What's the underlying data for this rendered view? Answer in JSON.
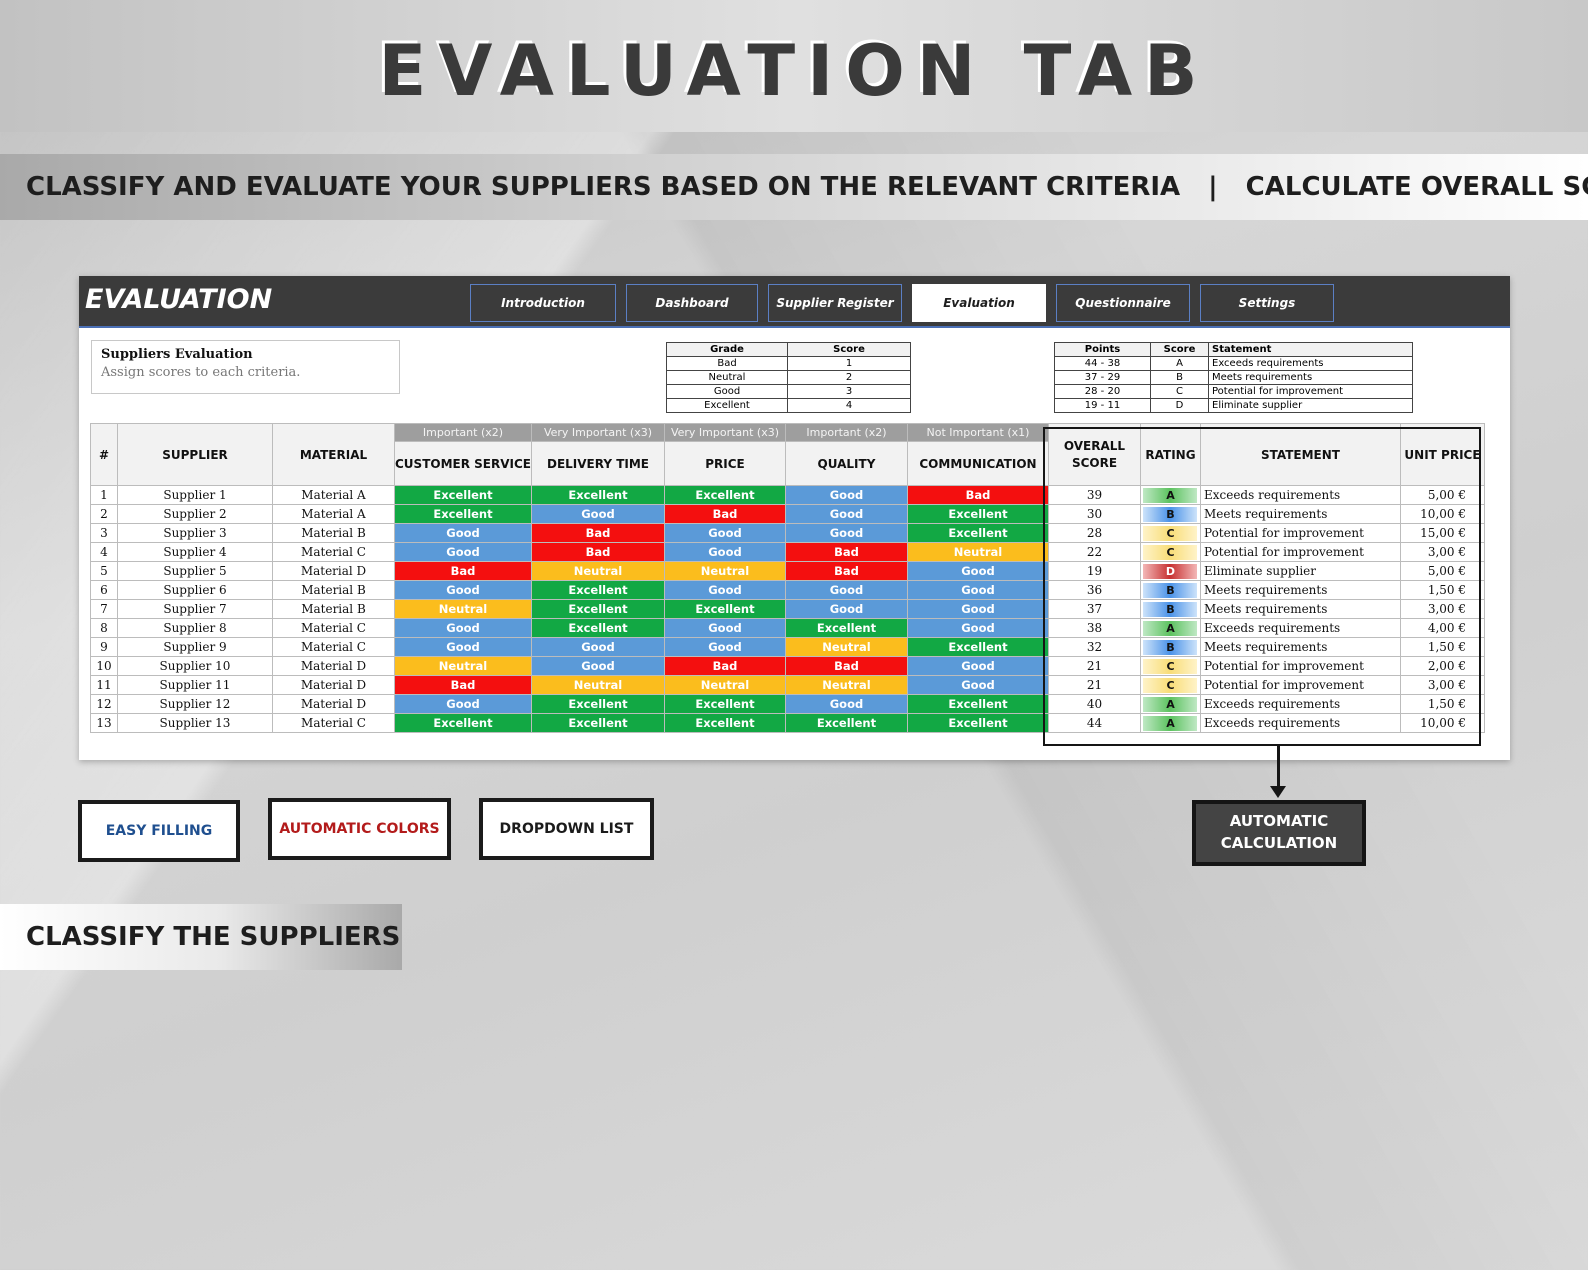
{
  "title": "EVALUATION TAB",
  "subtitle": {
    "left": "CLASSIFY AND EVALUATE YOUR SUPPLIERS BASED ON THE RELEVANT CRITERIA",
    "separator": "|",
    "right": "CALCULATE  OVERALL SCORE"
  },
  "sheet": {
    "title": "EVALUATION",
    "tabs": [
      "Introduction",
      "Dashboard",
      "Supplier Register",
      "Evaluation",
      "Questionnaire",
      "Settings"
    ],
    "active_tab": "Evaluation",
    "info": {
      "title": "Suppliers Evaluation",
      "description": "Assign scores to each criteria."
    },
    "grade_legend": {
      "headers": [
        "Grade",
        "Score"
      ],
      "rows": [
        [
          "Bad",
          "1"
        ],
        [
          "Neutral",
          "2"
        ],
        [
          "Good",
          "3"
        ],
        [
          "Excellent",
          "4"
        ]
      ]
    },
    "rating_legend": {
      "headers": [
        "Points",
        "Score",
        "Statement"
      ],
      "rows": [
        [
          "44 - 38",
          "A",
          "Exceeds requirements"
        ],
        [
          "37 - 29",
          "B",
          "Meets requirements"
        ],
        [
          "28 - 20",
          "C",
          "Potential for improvement"
        ],
        [
          "19 - 11",
          "D",
          "Eliminate supplier"
        ]
      ]
    },
    "table": {
      "headers": {
        "index": "#",
        "supplier": "SUPPLIER",
        "material": "MATERIAL",
        "overall_score": "OVERALL SCORE",
        "rating": "RATING",
        "statement": "STATEMENT",
        "unit_price": "UNIT PRICE"
      },
      "criteria": [
        {
          "weight": "Important (x2)",
          "name": "CUSTOMER SERVICE"
        },
        {
          "weight": "Very Important (x3)",
          "name": "DELIVERY TIME"
        },
        {
          "weight": "Very Important (x3)",
          "name": "PRICE"
        },
        {
          "weight": "Important (x2)",
          "name": "QUALITY"
        },
        {
          "weight": "Not Important (x1)",
          "name": "COMMUNICATION"
        }
      ],
      "rows": [
        {
          "n": "1",
          "supplier": "Supplier 1",
          "material": "Material A",
          "grades": [
            "Excellent",
            "Excellent",
            "Excellent",
            "Good",
            "Bad"
          ],
          "score": "39",
          "rating": "A",
          "statement": "Exceeds requirements",
          "price": "5,00 €"
        },
        {
          "n": "2",
          "supplier": "Supplier 2",
          "material": "Material A",
          "grades": [
            "Excellent",
            "Good",
            "Bad",
            "Good",
            "Excellent"
          ],
          "score": "30",
          "rating": "B",
          "statement": "Meets requirements",
          "price": "10,00 €"
        },
        {
          "n": "3",
          "supplier": "Supplier 3",
          "material": "Material B",
          "grades": [
            "Good",
            "Bad",
            "Good",
            "Good",
            "Excellent"
          ],
          "score": "28",
          "rating": "C",
          "statement": "Potential for improvement",
          "price": "15,00 €"
        },
        {
          "n": "4",
          "supplier": "Supplier 4",
          "material": "Material C",
          "grades": [
            "Good",
            "Bad",
            "Good",
            "Bad",
            "Neutral"
          ],
          "score": "22",
          "rating": "C",
          "statement": "Potential for improvement",
          "price": "3,00 €"
        },
        {
          "n": "5",
          "supplier": "Supplier 5",
          "material": "Material D",
          "grades": [
            "Bad",
            "Neutral",
            "Neutral",
            "Bad",
            "Good"
          ],
          "score": "19",
          "rating": "D",
          "statement": "Eliminate supplier",
          "price": "5,00 €"
        },
        {
          "n": "6",
          "supplier": "Supplier 6",
          "material": "Material B",
          "grades": [
            "Good",
            "Excellent",
            "Good",
            "Good",
            "Good"
          ],
          "score": "36",
          "rating": "B",
          "statement": "Meets requirements",
          "price": "1,50 €"
        },
        {
          "n": "7",
          "supplier": "Supplier 7",
          "material": "Material B",
          "grades": [
            "Neutral",
            "Excellent",
            "Excellent",
            "Good",
            "Good"
          ],
          "score": "37",
          "rating": "B",
          "statement": "Meets requirements",
          "price": "3,00 €"
        },
        {
          "n": "8",
          "supplier": "Supplier 8",
          "material": "Material C",
          "grades": [
            "Good",
            "Excellent",
            "Good",
            "Excellent",
            "Good"
          ],
          "score": "38",
          "rating": "A",
          "statement": "Exceeds requirements",
          "price": "4,00 €"
        },
        {
          "n": "9",
          "supplier": "Supplier 9",
          "material": "Material C",
          "grades": [
            "Good",
            "Good",
            "Good",
            "Neutral",
            "Excellent"
          ],
          "score": "32",
          "rating": "B",
          "statement": "Meets requirements",
          "price": "1,50 €"
        },
        {
          "n": "10",
          "supplier": "Supplier 10",
          "material": "Material D",
          "grades": [
            "Neutral",
            "Good",
            "Bad",
            "Bad",
            "Good"
          ],
          "score": "21",
          "rating": "C",
          "statement": "Potential for improvement",
          "price": "2,00 €"
        },
        {
          "n": "11",
          "supplier": "Supplier 11",
          "material": "Material D",
          "grades": [
            "Bad",
            "Neutral",
            "Neutral",
            "Neutral",
            "Good"
          ],
          "score": "21",
          "rating": "C",
          "statement": "Potential for improvement",
          "price": "3,00 €"
        },
        {
          "n": "12",
          "supplier": "Supplier 12",
          "material": "Material D",
          "grades": [
            "Good",
            "Excellent",
            "Excellent",
            "Good",
            "Excellent"
          ],
          "score": "40",
          "rating": "A",
          "statement": "Exceeds requirements",
          "price": "1,50 €"
        },
        {
          "n": "13",
          "supplier": "Supplier 13",
          "material": "Material C",
          "grades": [
            "Excellent",
            "Excellent",
            "Excellent",
            "Excellent",
            "Excellent"
          ],
          "score": "44",
          "rating": "A",
          "statement": "Exceeds requirements",
          "price": "10,00 €"
        }
      ]
    }
  },
  "features": {
    "easy_filling": {
      "label": "EASY FILLING",
      "color": "#1f4f8f"
    },
    "automatic_colors": {
      "label": "AUTOMATIC COLORS",
      "color": "#b31b1b"
    },
    "dropdown_list": {
      "label": "DROPDOWN LIST",
      "color": "#1b1b1b"
    },
    "automatic_calculation": {
      "label": "AUTOMATIC CALCULATION"
    }
  },
  "bottom_banner": "CLASSIFY THE SUPPLIERS",
  "colors": {
    "Excellent": "#12a844",
    "Good": "#5b9ad8",
    "Bad": "#f40f0f",
    "Neutral": "#fbbd1d",
    "header_dark": "#3b3b3b",
    "tab_border": "#5b7fc4"
  }
}
